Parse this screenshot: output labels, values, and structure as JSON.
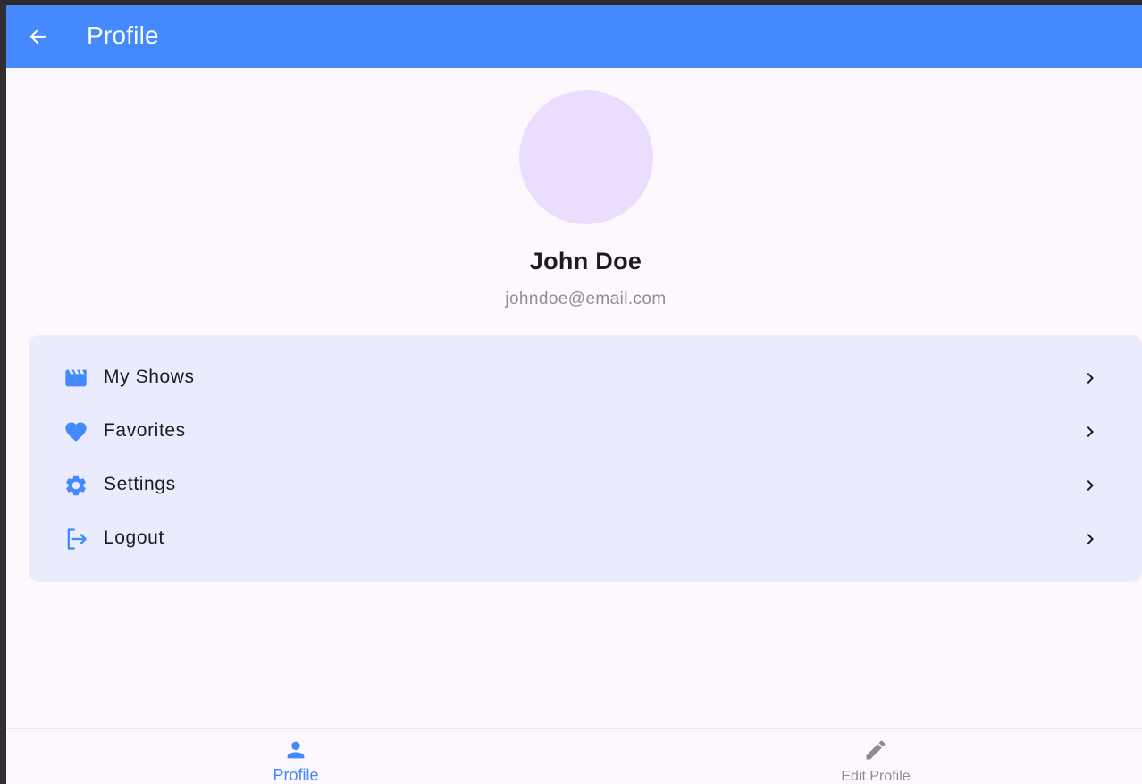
{
  "appbar": {
    "title": "Profile",
    "back_icon": "arrow-back-icon",
    "background_color": "#4489fe"
  },
  "profile": {
    "name": "John Doe",
    "email": "johndoe@email.com",
    "avatar_color": "#eaddfe"
  },
  "menu": {
    "items": [
      {
        "label": "My Shows",
        "icon": "movie-clapper-icon"
      },
      {
        "label": "Favorites",
        "icon": "heart-icon"
      },
      {
        "label": "Settings",
        "icon": "gear-icon"
      },
      {
        "label": "Logout",
        "icon": "logout-icon"
      }
    ],
    "trailing_icon": "chevron-right-icon",
    "card_color": "#eaebfc",
    "icon_color": "#4489fe"
  },
  "bottom_nav": {
    "items": [
      {
        "label": "Profile",
        "icon": "person-icon",
        "selected": true
      },
      {
        "label": "Edit Profile",
        "icon": "pencil-icon",
        "selected": false
      }
    ],
    "active_color": "#4489fe",
    "inactive_color": "#8f8c93"
  }
}
